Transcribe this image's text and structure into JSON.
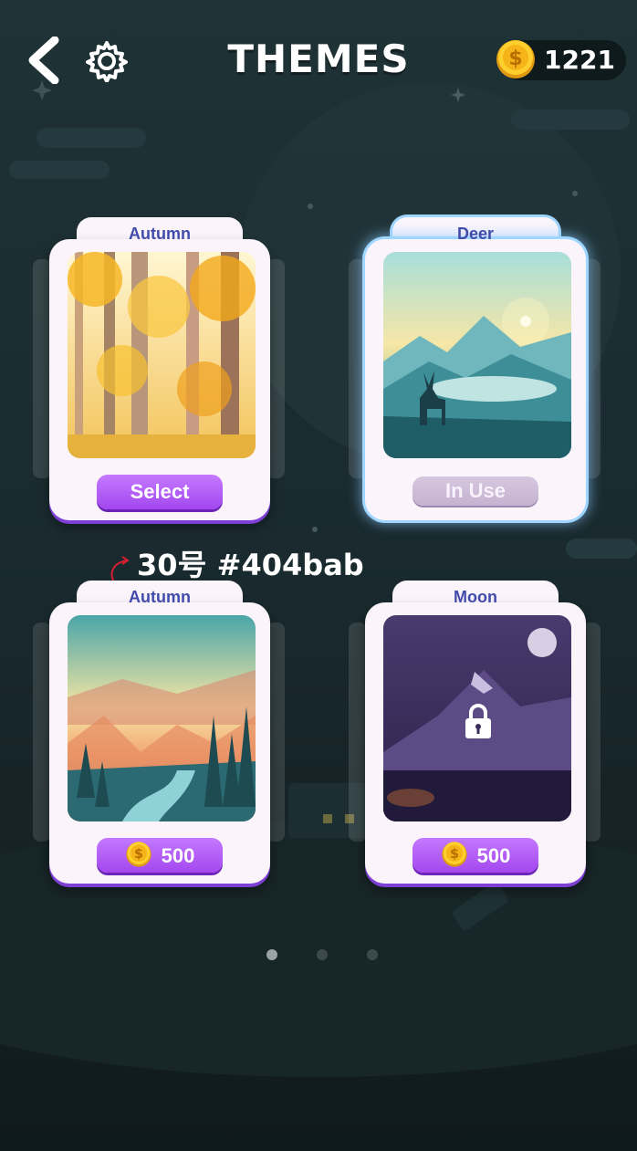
{
  "header": {
    "title": "THEMES",
    "coins": "1221"
  },
  "icons": {
    "back": "chevron-left-icon",
    "settings": "gear-icon",
    "coin": "gold-dollar-coin-icon",
    "lock": "padlock-icon"
  },
  "cards": [
    {
      "title": "Autumn",
      "button_label": "Select",
      "state": "owned"
    },
    {
      "title": "Deer",
      "button_label": "In Use",
      "state": "in-use"
    },
    {
      "title": "Autumn",
      "button_label": "500",
      "state": "purchasable"
    },
    {
      "title": "Moon",
      "button_label": "500",
      "state": "locked"
    }
  ],
  "annotation": {
    "text": "30号 #404bab"
  },
  "pagination": {
    "pages": 3,
    "current": 1
  },
  "colors": {
    "card_title": "#404bab",
    "button_purple": "#a347ef",
    "in_use_button": "#c5b3d1",
    "annotation_red": "#d21f2f"
  }
}
